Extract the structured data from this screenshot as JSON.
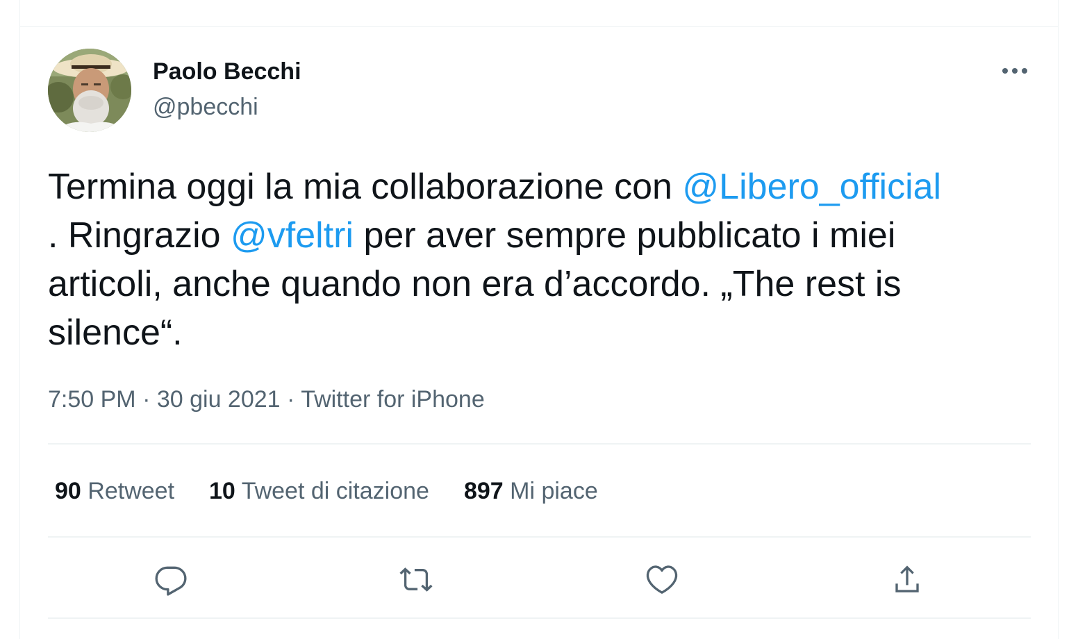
{
  "tweet": {
    "author": {
      "display_name": "Paolo Becchi",
      "handle": "@pbecchi"
    },
    "text_lines": [
      [
        {
          "type": "text",
          "value": "Termina oggi la mia collaborazione con "
        },
        {
          "type": "mention",
          "value": "@Libero_official"
        }
      ],
      [
        {
          "type": "text",
          "value": ". Ringrazio "
        },
        {
          "type": "mention",
          "value": "@vfeltri"
        },
        {
          "type": "text",
          "value": " per aver sempre pubblicato i miei"
        }
      ],
      [
        {
          "type": "text",
          "value": "articoli, anche quando non era d’accordo. „The rest is"
        }
      ],
      [
        {
          "type": "text",
          "value": "silence“."
        }
      ]
    ],
    "meta": {
      "time": "7:50 PM",
      "date": "30 giu 2021",
      "source": "Twitter for iPhone",
      "separator": " · "
    },
    "stats": [
      {
        "count": "90",
        "label": "Retweet"
      },
      {
        "count": "10",
        "label": "Tweet di citazione"
      },
      {
        "count": "897",
        "label": "Mi piace"
      }
    ]
  },
  "icons": {
    "more": "more-horizontal-icon",
    "reply": "reply-icon",
    "retweet": "retweet-icon",
    "like": "like-icon",
    "share": "share-icon"
  },
  "colors": {
    "text_primary": "#0f1419",
    "text_secondary": "#536471",
    "link": "#1d9bf0",
    "divider": "#eff3f4"
  }
}
